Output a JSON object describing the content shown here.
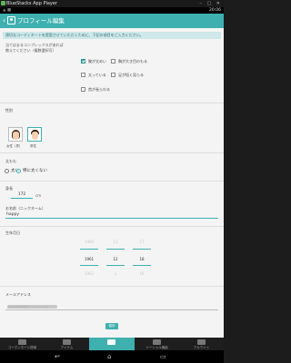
{
  "window": {
    "title": "BlueStacks App Player",
    "controls": "– ▢ ✕"
  },
  "status": {
    "time": "20:06",
    "left_icons": "▲ ■"
  },
  "appbar": {
    "back_label": "‹",
    "title": "プロフィール編集"
  },
  "notice": "適切なコーディネートを提案させていただくために、下記の項目をご入力ください。",
  "question": {
    "line1": "当てはまるコンプレックスがあれば",
    "line2": "教えてください（複数選択可）"
  },
  "complexes": [
    {
      "label": "腕が太めい",
      "checked": true
    },
    {
      "label": "胸が大き目のもる",
      "checked": false
    },
    {
      "label": "太っている",
      "checked": false
    },
    {
      "label": "足が短く見らる",
      "checked": false
    },
    {
      "label": "首が長らわる",
      "checked": false
    }
  ],
  "gender": {
    "label": "性別",
    "female_label": "女性（男）",
    "male_label": "男性"
  },
  "body": {
    "label": "太もも",
    "options": [
      "太い",
      "特に太くない"
    ],
    "selected_index": 1
  },
  "height": {
    "label": "身長",
    "value": "172",
    "unit": "cm"
  },
  "nickname": {
    "label": "お名前（ニックネーム）",
    "value": "happy"
  },
  "birthday": {
    "label": "生年月日",
    "rows": [
      [
        "1960",
        "11",
        "17"
      ],
      [
        "1961",
        "12",
        "18"
      ],
      [
        "1962",
        "1",
        "19"
      ]
    ]
  },
  "email": {
    "label": "メールアドレス",
    "value_obscured": "●●●●●●●@yahoo.co.jp"
  },
  "save_label": "保存",
  "bottom_nav": [
    {
      "label": "コーディネート提案"
    },
    {
      "label": "アイテム"
    },
    {
      "label": ""
    },
    {
      "label": "ソーシャル機能"
    },
    {
      "label": "アカウント"
    }
  ],
  "active_tab_index": 2,
  "sysnav": {
    "back": "↩",
    "home": "⌂",
    "recent": "▭"
  },
  "colors": {
    "accent": "#3fb0b0"
  }
}
